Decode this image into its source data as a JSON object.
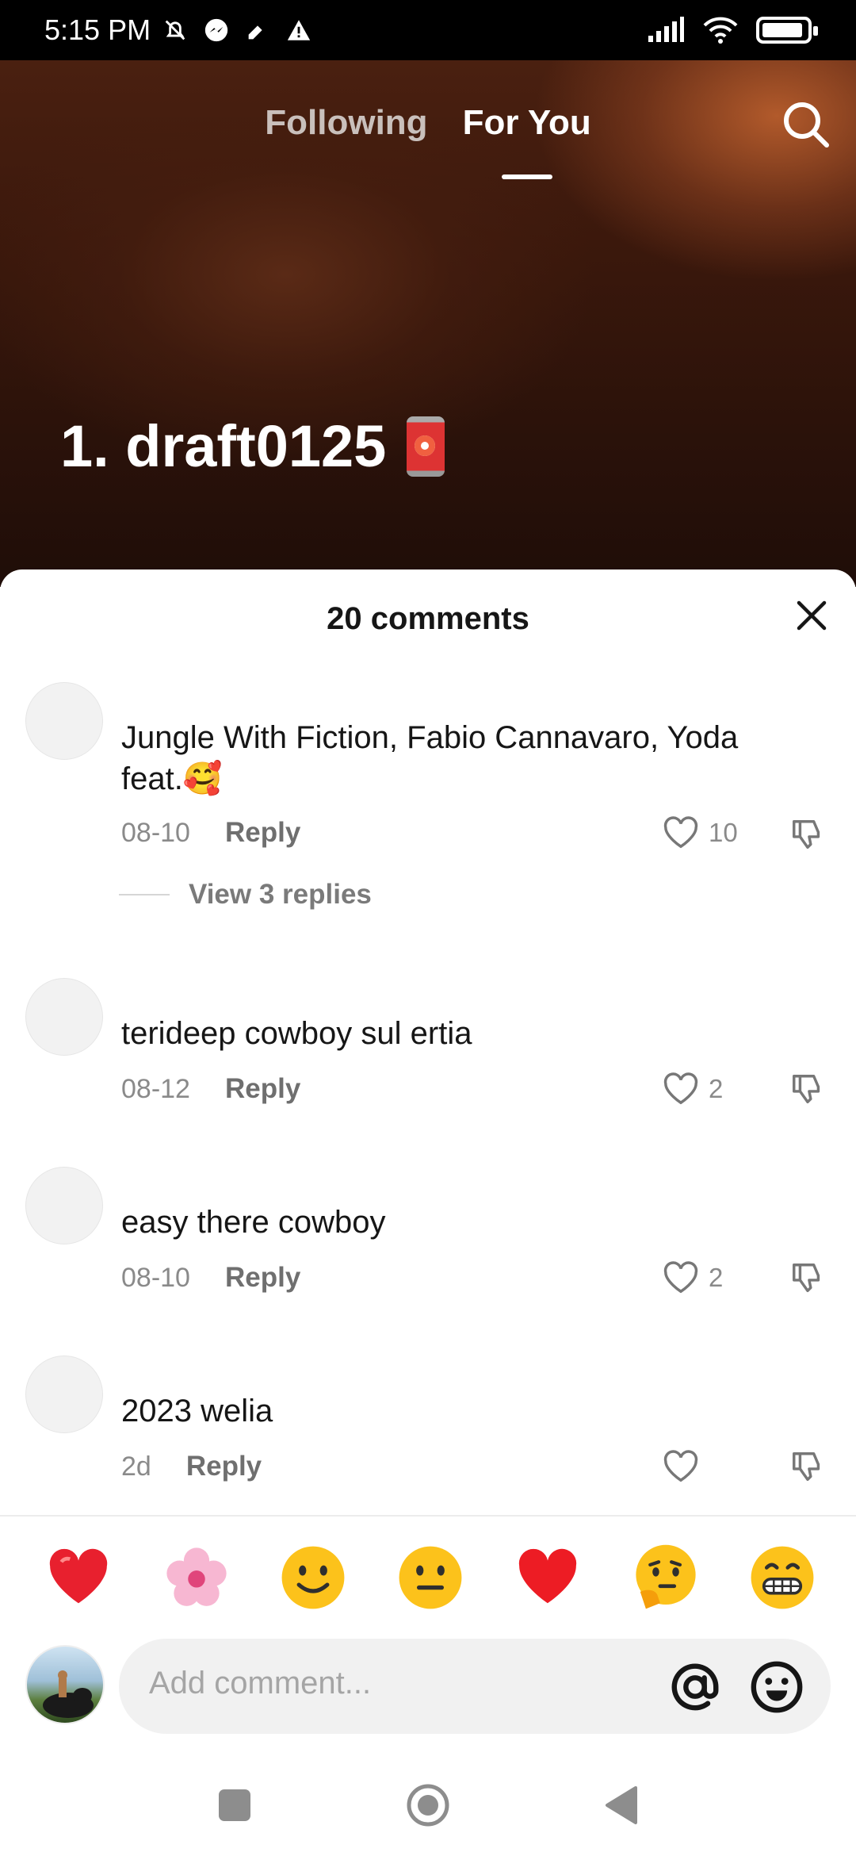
{
  "status_bar": {
    "time": "5:15 PM"
  },
  "feed": {
    "tabs": {
      "following": "Following",
      "for_you": "For You"
    },
    "video_caption": "1. draft0125"
  },
  "comments_sheet": {
    "header": "20 comments",
    "comments": [
      {
        "text": "Jungle With Fiction, Fabio Cannavaro, Yoda feat.🥰",
        "date": "08-10",
        "reply": "Reply",
        "likes": "10",
        "view_replies": "View 3 replies"
      },
      {
        "text": "terideep cowboy sul ertia",
        "date": "08-12",
        "reply": "Reply",
        "likes": "2"
      },
      {
        "text": "easy there cowboy",
        "date": "08-10",
        "reply": "Reply",
        "likes": "2"
      },
      {
        "text": "2023 welia",
        "date": "2d",
        "reply": "Reply",
        "likes": ""
      }
    ],
    "emoji_bar": [
      "❤️",
      "🌸",
      "🙂",
      "😐",
      "❤️",
      "🤔",
      "😁"
    ],
    "composer": {
      "placeholder": "Add comment..."
    }
  },
  "colors": {
    "sheet_bg": "#ffffff",
    "text": "#161616",
    "muted": "#8a8a8a",
    "heart_red": "#e8202e"
  }
}
